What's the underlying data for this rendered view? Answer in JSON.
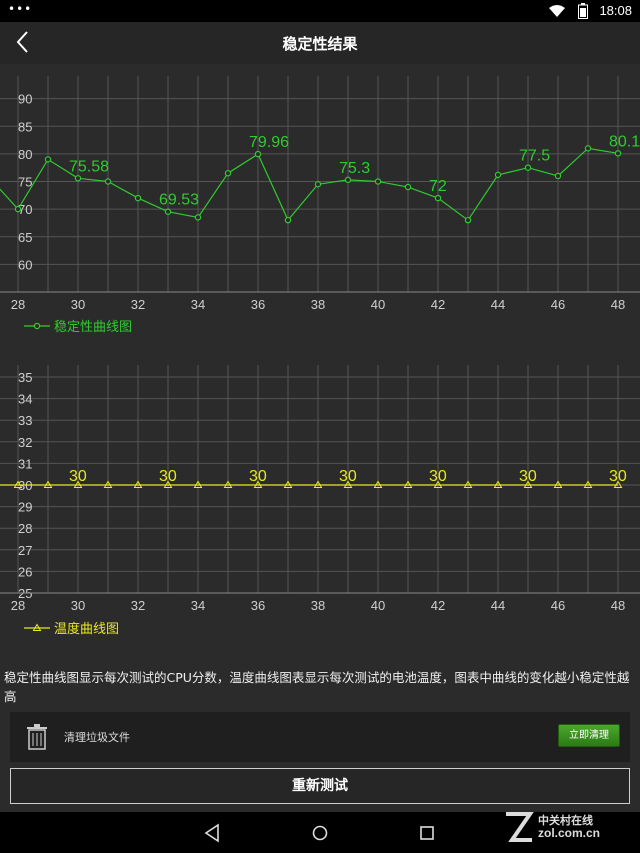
{
  "status_bar": {
    "dots": "•••",
    "time": "18:08"
  },
  "app_bar": {
    "title": "稳定性结果"
  },
  "cpu_chart": {
    "legend": "稳定性曲线图",
    "color": "#2ecc2e",
    "chart_data": {
      "type": "line",
      "x": [
        27,
        28,
        29,
        30,
        31,
        32,
        33,
        34,
        35,
        36,
        37,
        38,
        39,
        40,
        41,
        42,
        43,
        44,
        45,
        46,
        47,
        48
      ],
      "values": [
        76,
        70,
        79,
        75.58,
        75,
        72,
        69.53,
        68.5,
        76.5,
        79.96,
        68,
        74.5,
        75.3,
        75,
        74,
        72,
        68,
        76.2,
        77.5,
        76,
        81,
        80.1
      ],
      "data_labels": [
        {
          "x": 30,
          "label": "75.58"
        },
        {
          "x": 33,
          "label": "69.53"
        },
        {
          "x": 36,
          "label": "79.96"
        },
        {
          "x": 39,
          "label": "75.3"
        },
        {
          "x": 42,
          "label": "72"
        },
        {
          "x": 45,
          "label": "77.5"
        },
        {
          "x": 48,
          "label": "80.1"
        }
      ],
      "y_ticks": [
        "90",
        "85",
        "80",
        "75",
        "70",
        "65",
        "60"
      ],
      "x_ticks": [
        "28",
        "30",
        "32",
        "34",
        "36",
        "38",
        "40",
        "42",
        "44",
        "46",
        "48"
      ],
      "ylim": [
        55,
        95
      ],
      "xlim": [
        28,
        48
      ]
    }
  },
  "temp_chart": {
    "legend": "温度曲线图",
    "color": "#e8e820",
    "chart_data": {
      "type": "line",
      "x": [
        27,
        28,
        29,
        30,
        31,
        32,
        33,
        34,
        35,
        36,
        37,
        38,
        39,
        40,
        41,
        42,
        43,
        44,
        45,
        46,
        47,
        48
      ],
      "values": [
        30,
        30,
        30,
        30,
        30,
        30,
        30,
        30,
        30,
        30,
        30,
        30,
        30,
        30,
        30,
        30,
        30,
        30,
        30,
        30,
        30,
        30
      ],
      "data_labels": [
        {
          "x": 30,
          "label": "30"
        },
        {
          "x": 33,
          "label": "30"
        },
        {
          "x": 36,
          "label": "30"
        },
        {
          "x": 39,
          "label": "30"
        },
        {
          "x": 42,
          "label": "30"
        },
        {
          "x": 45,
          "label": "30"
        },
        {
          "x": 48,
          "label": "30"
        }
      ],
      "y_ticks": [
        "35",
        "34",
        "33",
        "32",
        "31",
        "30",
        "29",
        "28",
        "27",
        "26",
        "25"
      ],
      "x_ticks": [
        "28",
        "30",
        "32",
        "34",
        "36",
        "38",
        "40",
        "42",
        "44",
        "46",
        "48"
      ],
      "ylim": [
        25,
        35
      ],
      "xlim": [
        28,
        48
      ]
    }
  },
  "description": "稳定性曲线图显示每次测试的CPU分数，温度曲线图表显示每次测试的电池温度，图表中曲线的变化越小稳定性越高",
  "cleanup": {
    "label": "清理垃圾文件",
    "button": "立即清理"
  },
  "retest_button": "重新测试",
  "watermark": {
    "cn": "中关村在线",
    "en": "zol.com.cn"
  }
}
